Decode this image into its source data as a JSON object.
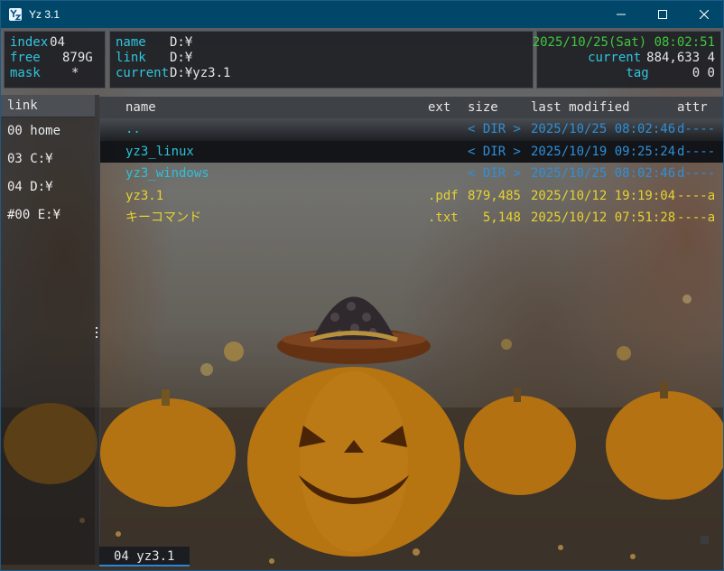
{
  "window": {
    "title": "Yz 3.1",
    "app_icon": "yz-app-icon",
    "controls": [
      "minimize-icon",
      "maximize-icon",
      "close-icon"
    ]
  },
  "info": {
    "index_label": "index",
    "index_value": "04",
    "free_label": "free",
    "free_value": "879G",
    "mask_label": "mask",
    "mask_value": "*",
    "name_label": "name",
    "name_value": "D:¥",
    "link_label": "link",
    "link_value": "D:¥",
    "current_label": "current",
    "current_value": "D:¥yz3.1",
    "datetime": "2025/10/25(Sat) 08:02:51",
    "current_count_label": "current",
    "current_count_value": "884,633 4",
    "tag_label": "tag",
    "tag_value": "0 0"
  },
  "link_panel": {
    "header": "link",
    "items": [
      "00 home",
      "03 C:¥",
      "04 D:¥",
      "#00 E:¥"
    ]
  },
  "file_list": {
    "headers": {
      "name": "name",
      "ext": "ext",
      "size": "size",
      "modified": "last modified",
      "attr": "attr"
    },
    "rows": [
      {
        "name": "..",
        "ext": "",
        "size": "< DIR >",
        "modified": "2025/10/25 08:02:46",
        "attr": "d----"
      },
      {
        "name": "yz3_linux",
        "ext": "",
        "size": "< DIR >",
        "modified": "2025/10/19 09:25:24",
        "attr": "d----"
      },
      {
        "name": "yz3_windows",
        "ext": "",
        "size": "< DIR >",
        "modified": "2025/10/25 08:02:46",
        "attr": "d----"
      },
      {
        "name": "yz3.1",
        "ext": ".pdf",
        "size": "879,485",
        "modified": "2025/10/12 19:19:04",
        "attr": "----a"
      },
      {
        "name": "キーコマンド",
        "ext": ".txt",
        "size": "5,148",
        "modified": "2025/10/12 07:51:28",
        "attr": "----a"
      }
    ]
  },
  "tabs": [
    {
      "label": "04 yz3.1"
    }
  ],
  "colors": {
    "titlebar": "#00476a",
    "directory_blue": "#2f8fd8",
    "directory_name": "#2fc0d8",
    "file_yellow": "#e6d231",
    "label_cyan": "#2fc6df",
    "datetime_green": "#3ec83e"
  }
}
